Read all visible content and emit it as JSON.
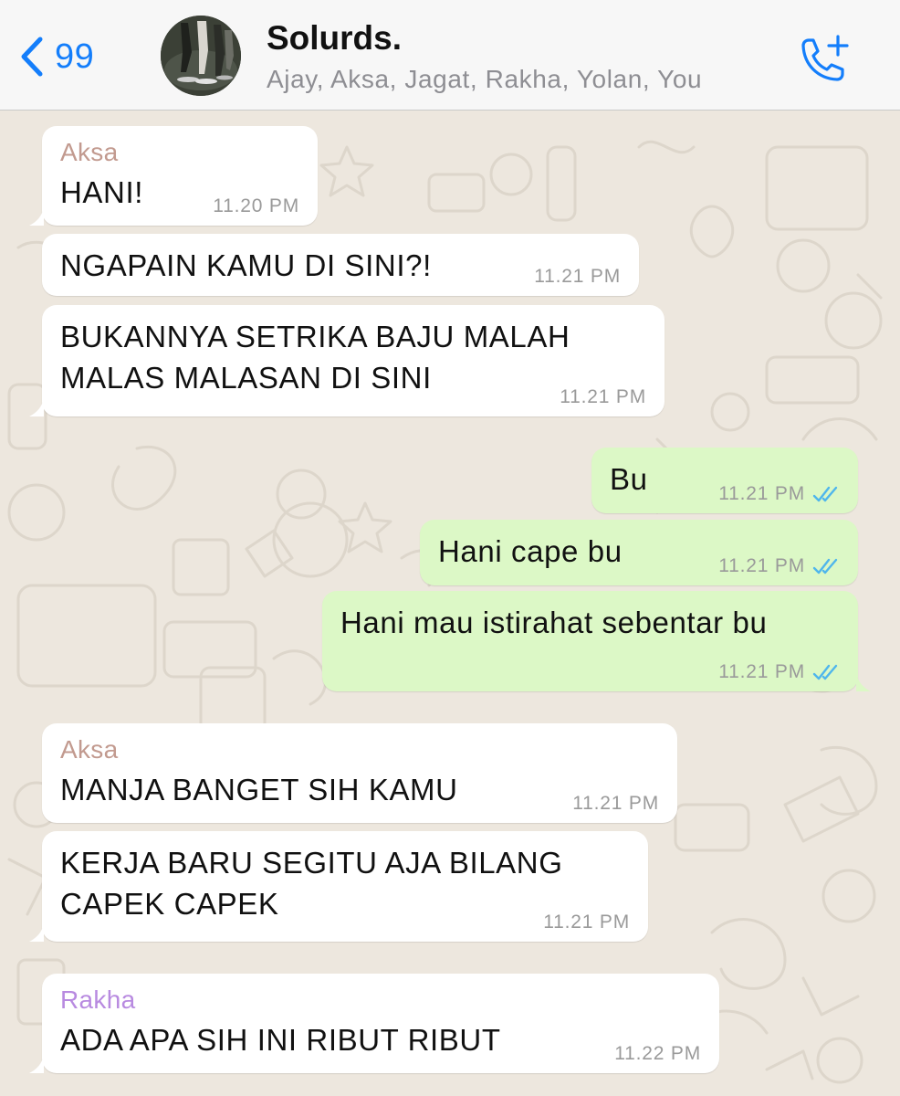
{
  "header": {
    "back_count": "99",
    "group_name": "Solurds.",
    "participants": "Ajay, Aksa, Jagat, Rakha, Yolan, You",
    "icons": {
      "back": "chevron-left-icon",
      "call": "add-call-icon"
    }
  },
  "colors": {
    "accent": "#147efb",
    "outgoing_bubble": "#dcf8c6",
    "incoming_bubble": "#ffffff",
    "sender_aksa": "#c29a8f",
    "sender_rakha": "#b88ae0",
    "read_ticks": "#4fb6ec"
  },
  "messages": [
    {
      "direction": "incoming",
      "sender": "Aksa",
      "lines": [
        "HANI!"
      ],
      "time": "11.20 PM"
    },
    {
      "direction": "incoming",
      "lines": [
        "NGAPAIN KAMU DI SINI?!"
      ],
      "time": "11.21 PM"
    },
    {
      "direction": "incoming",
      "lines": [
        "BUKANNYA SETRIKA BAJU MALAH",
        "MALAS MALASAN DI SINI"
      ],
      "time": "11.21 PM"
    },
    {
      "direction": "outgoing",
      "lines": [
        "Bu"
      ],
      "time": "11.21 PM",
      "status": "read"
    },
    {
      "direction": "outgoing",
      "lines": [
        "Hani cape bu"
      ],
      "time": "11.21 PM",
      "status": "read"
    },
    {
      "direction": "outgoing",
      "lines": [
        "Hani mau istirahat sebentar bu"
      ],
      "time": "11.21 PM",
      "status": "read"
    },
    {
      "direction": "incoming",
      "sender": "Aksa",
      "lines": [
        "MANJA BANGET SIH KAMU"
      ],
      "time": "11.21 PM"
    },
    {
      "direction": "incoming",
      "lines": [
        "KERJA BARU SEGITU AJA BILANG",
        "CAPEK CAPEK"
      ],
      "time": "11.21 PM"
    },
    {
      "direction": "incoming",
      "sender": "Rakha",
      "lines": [
        "ADA APA SIH INI RIBUT RIBUT"
      ],
      "time": "11.22 PM"
    }
  ]
}
